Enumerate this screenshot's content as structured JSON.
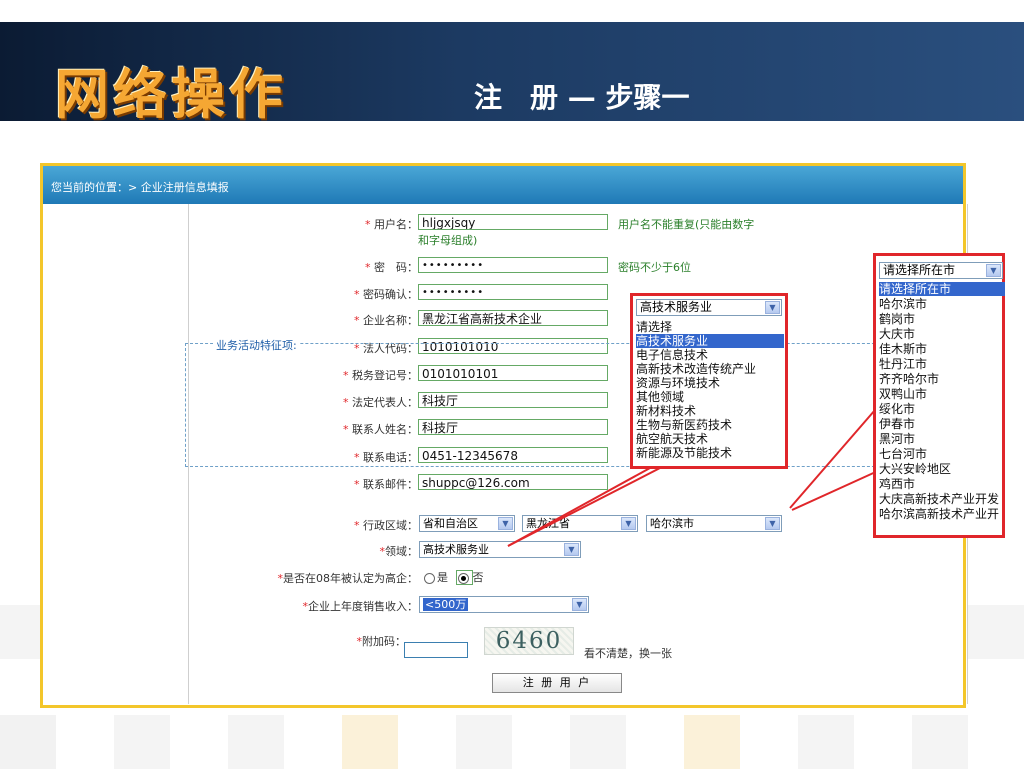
{
  "header": {
    "title": "网络操作",
    "subtitle": "注　册 — 步骤一"
  },
  "breadcrumb": "您当前的位置：> 企业注册信息填报",
  "form": {
    "username": {
      "label": "用户名：",
      "value": "hljgxjsqy",
      "hint_line1": "用户名不能重复(只能由数字",
      "hint_line2": "和字母组成)"
    },
    "password": {
      "label": "密　码：",
      "value": "•••••••••",
      "hint": "密码不少于6位"
    },
    "password_confirm": {
      "label": "密码确认：",
      "value": "•••••••••"
    },
    "company_name": {
      "label": "企业名称：",
      "value": "黑龙江省高新技术企业"
    },
    "legal_code": {
      "label": "法人代码：",
      "value": "1010101010"
    },
    "tax_no": {
      "label": "税务登记号：",
      "value": "0101010101"
    },
    "legal_rep": {
      "label": "法定代表人：",
      "value": "科技厅"
    },
    "contact_name": {
      "label": "联系人姓名：",
      "value": "科技厅"
    },
    "phone": {
      "label": "联系电话：",
      "value": "0451-12345678"
    },
    "email": {
      "label": "联系邮件：",
      "value": "shuppc@126.com"
    },
    "section_title": "业务活动特征项:",
    "region": {
      "label": "行政区域：",
      "sel1": "省和自治区",
      "sel2": "黑龙江省",
      "sel3": "哈尔滨市"
    },
    "domain": {
      "label": "领域：",
      "value": "高技术服务业"
    },
    "certified": {
      "label": "是否在08年被认定为高企：",
      "yes": "是",
      "no": "否"
    },
    "revenue": {
      "label": "企业上年度销售收入：",
      "value": "<500万"
    },
    "captcha": {
      "label": "附加码：",
      "image_text": "6460",
      "refresh": "看不清楚，换一张"
    },
    "submit": "注 册 用 户"
  },
  "domain_dropdown": {
    "selected": "高技术服务业",
    "options": [
      "请选择",
      "高技术服务业",
      "电子信息技术",
      "高新技术改造传统产业",
      "资源与环境技术",
      "其他领域",
      "新材料技术",
      "生物与新医药技术",
      "航空航天技术",
      "新能源及节能技术"
    ]
  },
  "city_dropdown": {
    "selected": "请选择所在市",
    "options": [
      "请选择所在市",
      "哈尔滨市",
      "鹤岗市",
      "大庆市",
      "佳木斯市",
      "牡丹江市",
      "齐齐哈尔市",
      "双鸭山市",
      "绥化市",
      "伊春市",
      "黑河市",
      "七台河市",
      "大兴安岭地区",
      "鸡西市",
      "大庆高新技术产业开发",
      "哈尔滨高新技术产业开"
    ]
  },
  "colors": {
    "header_bg": "#1c3a62",
    "title_orange": "#f5a733",
    "frame_gold": "#f3c62a",
    "bar_blue": "#1f79b6",
    "callout_red": "#e0262a",
    "required_red": "#e0262a"
  }
}
